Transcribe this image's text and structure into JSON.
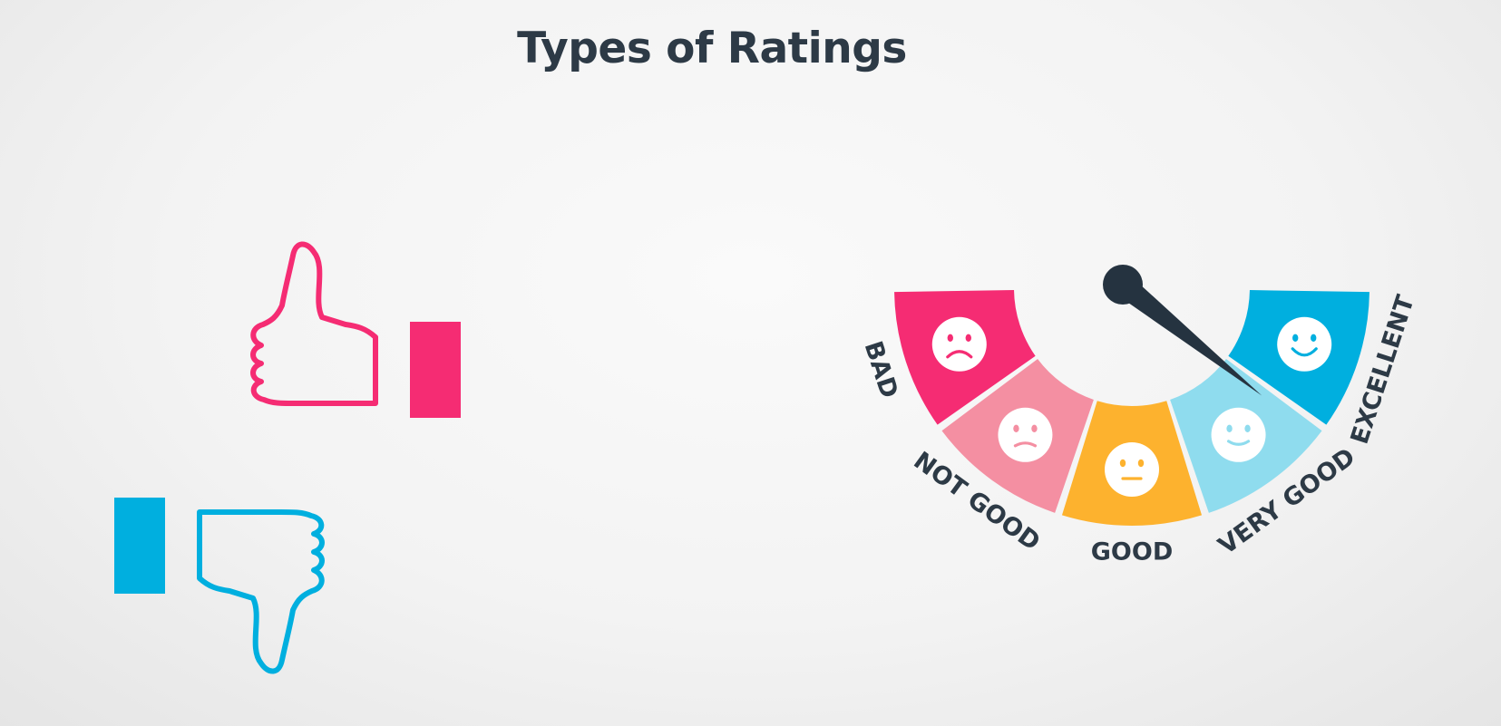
{
  "title": "Types of Ratings",
  "thumbs": {
    "up_color": "#f52c73",
    "down_color": "#00afdf"
  },
  "gauge": {
    "needle_color": "#253340",
    "value_fraction": 0.78,
    "segments": [
      {
        "label": "BAD",
        "color": "#f52c73",
        "face": "sad"
      },
      {
        "label": "NOT GOOD",
        "color": "#f48fa2",
        "face": "slightly-sad"
      },
      {
        "label": "GOOD",
        "color": "#fdb22e",
        "face": "neutral"
      },
      {
        "label": "VERY GOOD",
        "color": "#8fdcee",
        "face": "slight-smile"
      },
      {
        "label": "EXCELLENT",
        "color": "#00afdf",
        "face": "happy"
      }
    ]
  }
}
